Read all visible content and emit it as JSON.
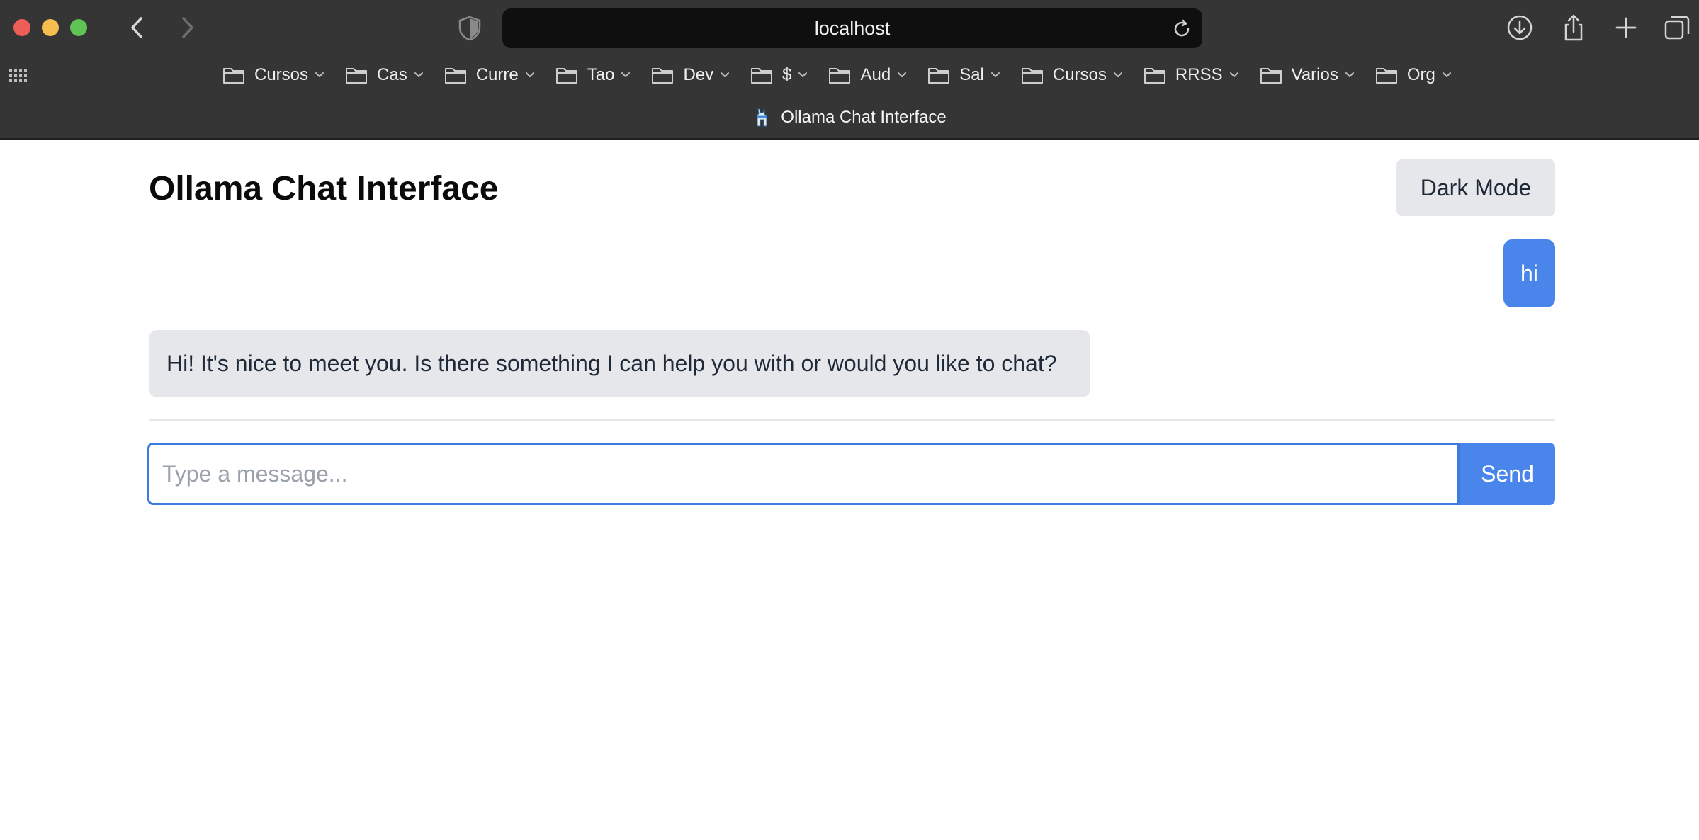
{
  "browser": {
    "url": "localhost",
    "tab_title": "Ollama Chat Interface",
    "bookmarks": [
      {
        "label": "Cursos"
      },
      {
        "label": "Cas"
      },
      {
        "label": "Curre"
      },
      {
        "label": "Tao"
      },
      {
        "label": "Dev"
      },
      {
        "label": "$"
      },
      {
        "label": "Aud"
      },
      {
        "label": "Sal"
      },
      {
        "label": "Cursos"
      },
      {
        "label": "RRSS"
      },
      {
        "label": "Varios"
      },
      {
        "label": "Org"
      }
    ],
    "icons": [
      "back-icon",
      "forward-icon",
      "shield-icon",
      "reload-icon",
      "download-icon",
      "share-icon",
      "new-tab-icon",
      "tab-overview-icon",
      "sidebar-grid-icon",
      "folder-icon",
      "chevron-down-icon",
      "favicon-llama-icon"
    ]
  },
  "app": {
    "title": "Ollama Chat Interface",
    "dark_mode_label": "Dark Mode",
    "messages": [
      {
        "role": "user",
        "text": "hi"
      },
      {
        "role": "assistant",
        "text": "Hi! It's nice to meet you. Is there something I can help you with or would you like to chat?"
      }
    ],
    "input": {
      "value": "",
      "placeholder": "Type a message..."
    },
    "send_label": "Send"
  },
  "colors": {
    "accent": "#4a85ec",
    "bubble_bot": "#e5e7eb",
    "chrome_bg": "#353535"
  }
}
